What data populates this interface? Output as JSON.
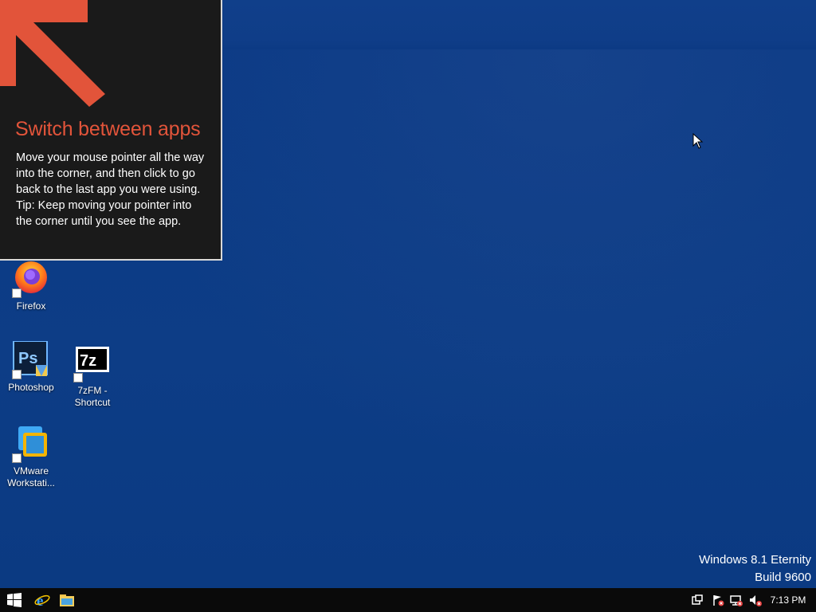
{
  "tip": {
    "title": "Switch between apps",
    "body_line1": "Move your mouse pointer all the way into the corner, and then click to go back to the last app you were using.",
    "body_line2": "Tip: Keep moving your pointer into the corner until you see the app.",
    "accent_color": "#e2543a"
  },
  "desktop_icons": [
    {
      "label": "Firefox",
      "icon": "firefox-icon"
    },
    {
      "label": "Photoshop",
      "icon": "photoshop-icon"
    },
    {
      "label": "7zFM - Shortcut",
      "icon": "7zip-icon"
    },
    {
      "label": "VMware Workstati...",
      "icon": "vmware-icon"
    }
  ],
  "branding": {
    "line1": "Windows 8.1 Eternity",
    "line2": "Build 9600"
  },
  "taskbar": {
    "start_icon": "windows-start-icon",
    "pinned": [
      "internet-explorer-icon",
      "file-explorer-icon"
    ],
    "tray": [
      "action-center-icon",
      "flag-error-icon",
      "network-error-icon",
      "volume-muted-icon"
    ],
    "clock": "7:13 PM"
  }
}
